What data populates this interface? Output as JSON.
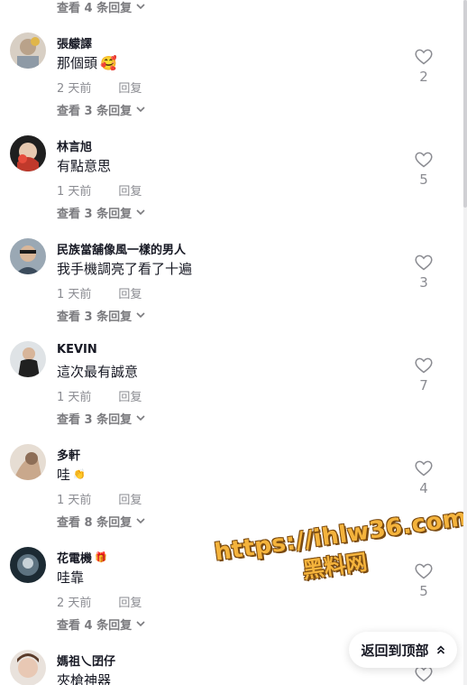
{
  "top_replies": "查看 4 条回复",
  "reply_label": "回复",
  "back_to_top": "返回到顶部",
  "watermark": {
    "line1": "https://ihlw36.com",
    "line2": "黑料网"
  },
  "comments": [
    {
      "username": "張艨譯",
      "text": "那個頭",
      "text_emoji": "🥰",
      "time": "2 天前",
      "likes": "2",
      "replies": "查看 3 条回复",
      "avatar_color": "#b9a28a"
    },
    {
      "username": "林言旭",
      "text": "有點意思",
      "time": "1 天前",
      "likes": "5",
      "replies": "查看 3 条回复",
      "avatar_color": "#c0392b"
    },
    {
      "username": "民族當舖像風一樣的男人",
      "text": "我手機調亮了看了十遍",
      "time": "1 天前",
      "likes": "3",
      "replies": "查看 3 条回复",
      "avatar_color": "#3b4b5c"
    },
    {
      "username": "KEVIN",
      "text": "這次最有誠意",
      "time": "1 天前",
      "likes": "7",
      "replies": "查看 3 条回复",
      "avatar_color": "#9aa3ad"
    },
    {
      "username": "多軒",
      "text": "哇",
      "text_emoji": "👏",
      "time": "1 天前",
      "likes": "4",
      "replies": "查看 8 条回复",
      "avatar_color": "#c9a88c"
    },
    {
      "username": "花電機",
      "username_emoji": "🎁",
      "text": "哇靠",
      "time": "2 天前",
      "likes": "5",
      "replies": "查看 4 条回复",
      "avatar_color": "#2f3b45"
    },
    {
      "username": "媽祖乀囝仔",
      "text": "夾槍神器",
      "avatar_color": "#c7b3a6"
    }
  ]
}
